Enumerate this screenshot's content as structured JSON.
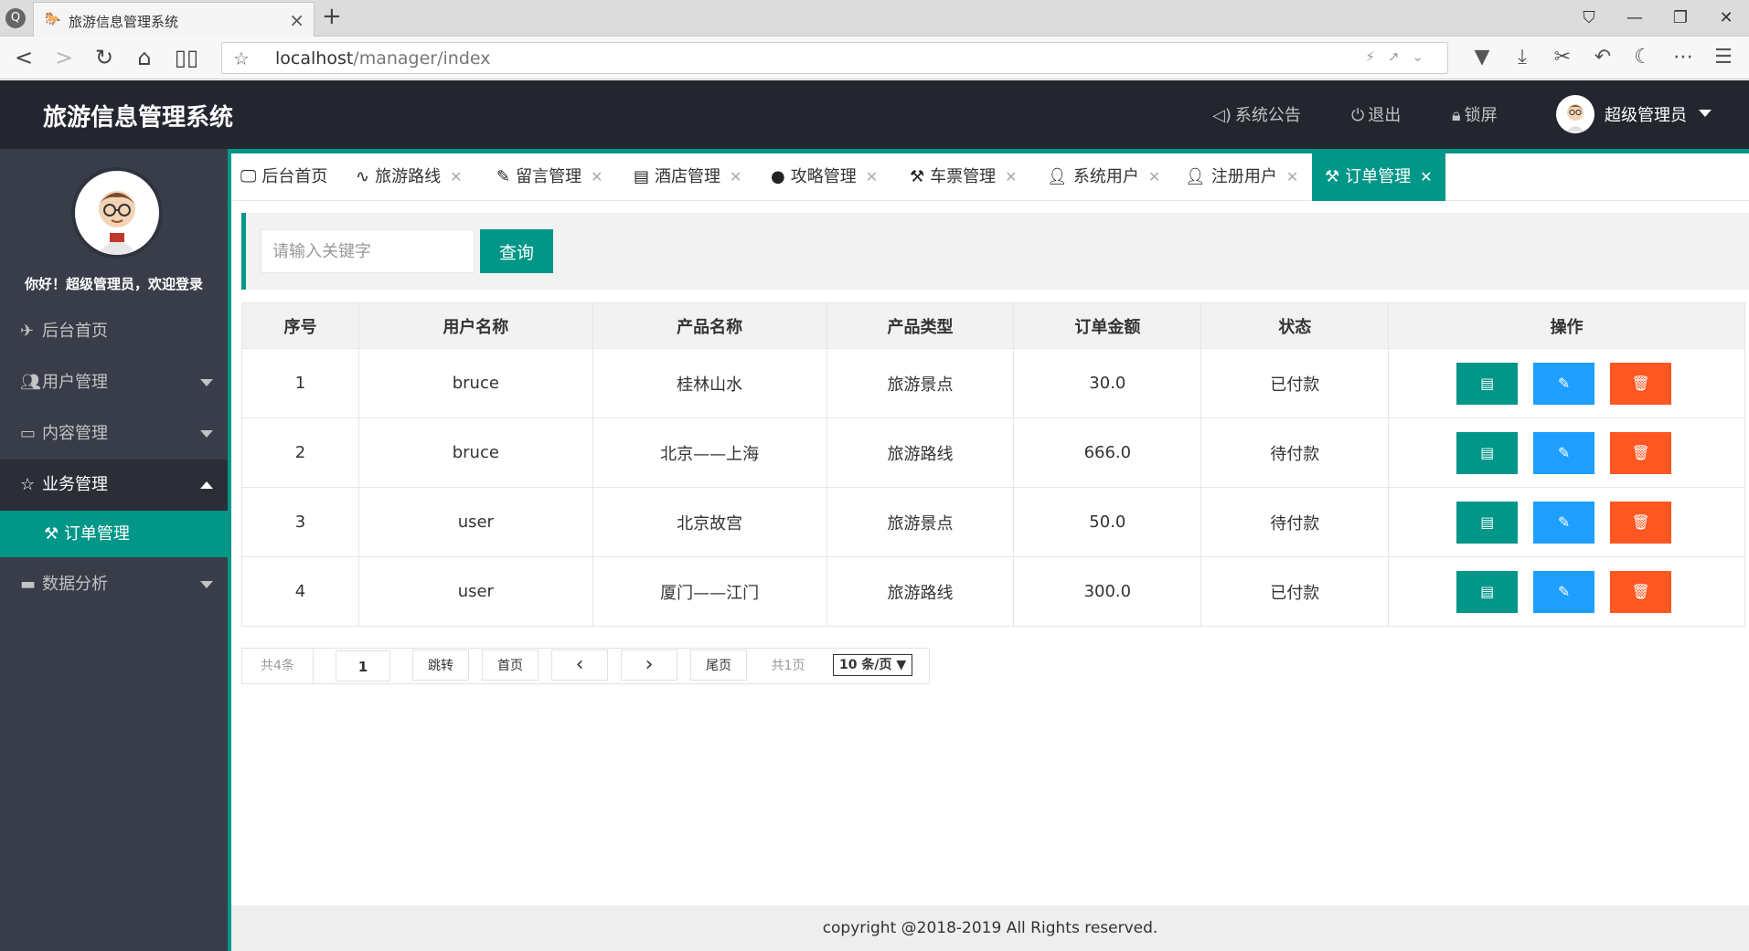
{
  "browser": {
    "tab_title": "旅游信息管理系统",
    "url_host": "localhost",
    "url_path": "/manager/index"
  },
  "header": {
    "title": "旅游信息管理系统",
    "announce": "系统公告",
    "logout": "退出",
    "lock": "锁屏",
    "user": "超级管理员"
  },
  "sidebar": {
    "welcome": "你好！超级管理员，欢迎登录",
    "items": [
      {
        "label": "后台首页"
      },
      {
        "label": "用户管理"
      },
      {
        "label": "内容管理"
      },
      {
        "label": "业务管理"
      },
      {
        "label": "订单管理"
      },
      {
        "label": "数据分析"
      }
    ]
  },
  "tabs": [
    {
      "label": "后台首页"
    },
    {
      "label": "旅游路线"
    },
    {
      "label": "留言管理"
    },
    {
      "label": "酒店管理"
    },
    {
      "label": "攻略管理"
    },
    {
      "label": "车票管理"
    },
    {
      "label": "系统用户"
    },
    {
      "label": "注册用户"
    },
    {
      "label": "订单管理"
    }
  ],
  "search": {
    "placeholder": "请输入关键字",
    "button": "查询"
  },
  "table": {
    "headers": [
      "序号",
      "用户名称",
      "产品名称",
      "产品类型",
      "订单金额",
      "状态",
      "操作"
    ],
    "rows": [
      [
        "1",
        "bruce",
        "桂林山水",
        "旅游景点",
        "30.0",
        "已付款"
      ],
      [
        "2",
        "bruce",
        "北京——上海",
        "旅游路线",
        "666.0",
        "待付款"
      ],
      [
        "3",
        "user",
        "北京故宫",
        "旅游景点",
        "50.0",
        "待付款"
      ],
      [
        "4",
        "user",
        "厦门——江门",
        "旅游路线",
        "300.0",
        "已付款"
      ]
    ]
  },
  "pager": {
    "total": "共4条",
    "page": "1",
    "jump": "跳转",
    "first": "首页",
    "last": "尾页",
    "pages": "共1页",
    "per_page": "10 条/页 ▼"
  },
  "footer": "copyright @2018-2019 All Rights reserved.",
  "colors": {
    "primary": "#009688",
    "blue": "#1e9fff",
    "orange": "#ff5722",
    "header_bg": "#23262e",
    "sidebar_bg": "#393d49"
  }
}
